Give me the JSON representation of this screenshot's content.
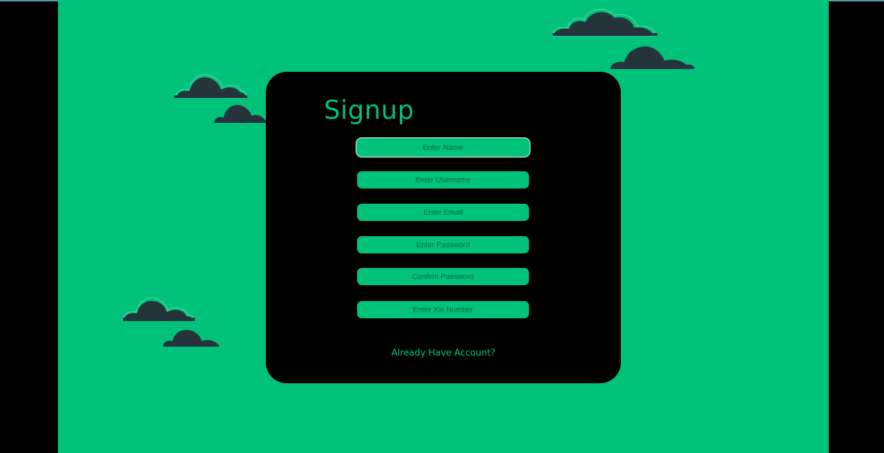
{
  "form": {
    "title": "Signup",
    "fields": [
      {
        "placeholder": "Enter Name",
        "value": ""
      },
      {
        "placeholder": "Enter Username",
        "value": ""
      },
      {
        "placeholder": "Enter Email",
        "value": ""
      },
      {
        "placeholder": "Enter Password",
        "value": ""
      },
      {
        "placeholder": "Confirm Password",
        "value": ""
      },
      {
        "placeholder": "Enter Xie Number",
        "value": ""
      }
    ],
    "login_link": "Already Have Account?"
  },
  "colors": {
    "background": "#00c27b",
    "card": "#000000",
    "accent": "#00c27b",
    "cloud": "#25343a"
  },
  "decorations": [
    "cloud-icon",
    "cloud-icon",
    "cloud-icon",
    "cloud-icon",
    "cloud-icon",
    "cloud-icon"
  ]
}
